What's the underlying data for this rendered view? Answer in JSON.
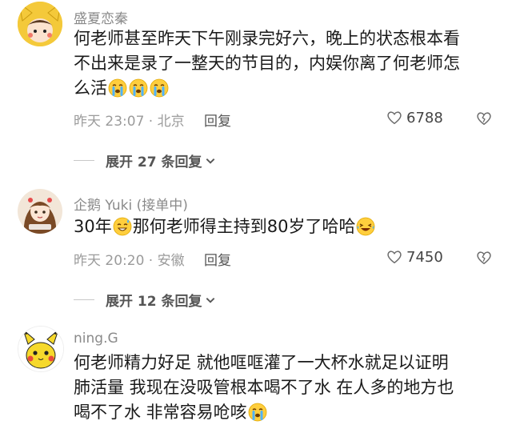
{
  "comments": [
    {
      "username": "盛夏恋秦",
      "lines": [
        "何老师甚至昨天下午刚录完好六，晚上的状态根本看",
        "不出来是录了一整天的节目的，内娱你离了何老师怎",
        "么活"
      ],
      "emojis": [
        "crying-emoji",
        "crying-emoji",
        "crying-emoji"
      ],
      "time": "昨天 23:07 · 北京",
      "reply_label": "回复",
      "likes": "6788",
      "expand": "展开 27 条回复"
    },
    {
      "username": "企鹅 Yuki (接单中)",
      "text_before": "30年",
      "text_middle": "那何老师得主持到80岁了哈哈",
      "emojis": [
        "sweat-smile-emoji",
        "laugh-tears-emoji"
      ],
      "time": "昨天 20:20 · 安徽",
      "reply_label": "回复",
      "likes": "7450",
      "expand": "展开 12 条回复"
    },
    {
      "username": "ning.G",
      "lines": [
        "何老师精力好足  就他哐哐灌了一大杯水就足以证明",
        "肺活量  我现在没吸管根本喝不了水  在人多的地方也",
        "喝不了水  非常容易呛咳"
      ],
      "emojis": [
        "crying-emoji"
      ]
    }
  ],
  "colors": {
    "text": "#1a1a1a",
    "meta": "#9b9b9b",
    "username": "#8a8a8a"
  }
}
